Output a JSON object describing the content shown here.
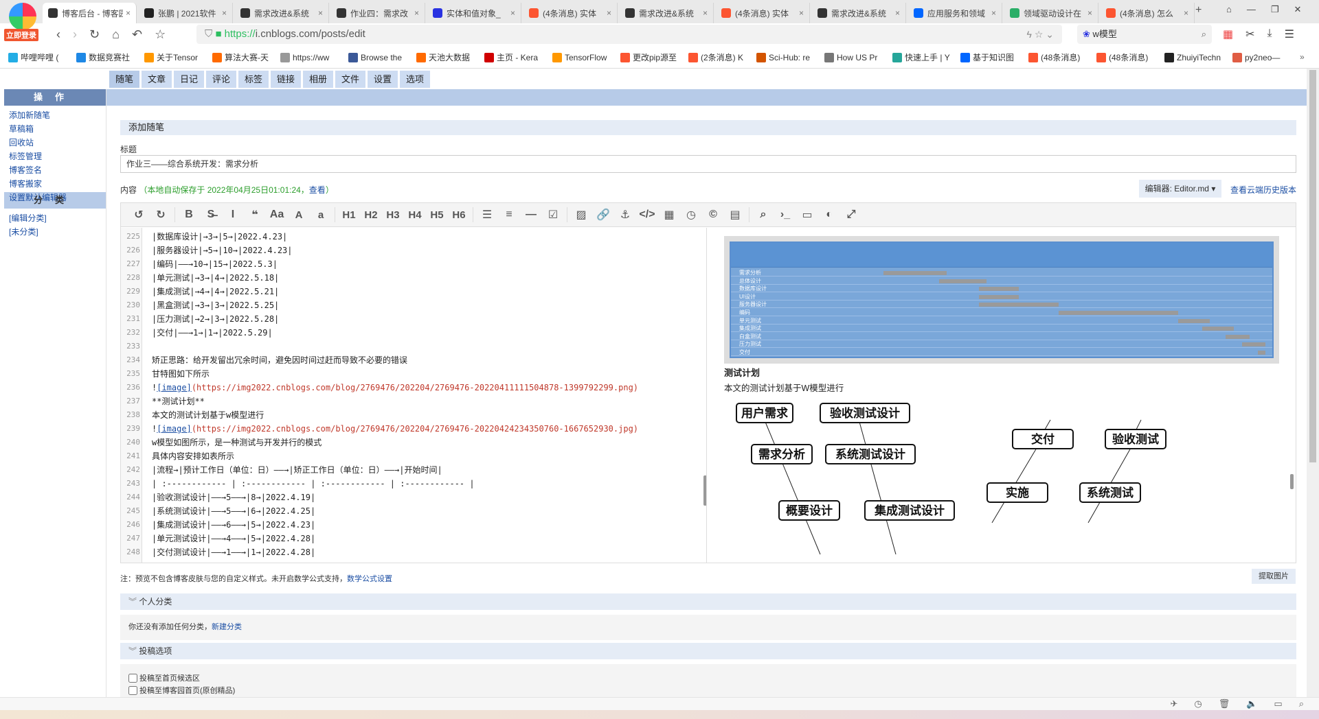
{
  "browser": {
    "login_badge": "立即登录",
    "tabs": [
      {
        "title": "博客后台 - 博客园",
        "icon": "cnblogs-icon",
        "color": "#333",
        "active": true
      },
      {
        "title": "张鹏 | 2021软件",
        "icon": "github-icon",
        "color": "#222"
      },
      {
        "title": "需求改进&系统",
        "icon": "cnblogs-icon",
        "color": "#333"
      },
      {
        "title": "作业四：需求改",
        "icon": "cnblogs-icon",
        "color": "#333"
      },
      {
        "title": "实体和值对象_",
        "icon": "baidu-icon",
        "color": "#2932e1"
      },
      {
        "title": "(4条消息) 实体",
        "icon": "csdn-icon",
        "color": "#fc5531"
      },
      {
        "title": "需求改进&系统",
        "icon": "cnblogs-icon",
        "color": "#333"
      },
      {
        "title": "(4条消息) 实体",
        "icon": "csdn-icon",
        "color": "#fc5531"
      },
      {
        "title": "需求改进&系统",
        "icon": "cnblogs-icon",
        "color": "#333"
      },
      {
        "title": "应用服务和领域",
        "icon": "zhihu-icon",
        "color": "#0066ff"
      },
      {
        "title": "领域驱动设计在",
        "icon": "wechat-icon",
        "color": "#2aae67"
      },
      {
        "title": "(4条消息) 怎么",
        "icon": "csdn-icon",
        "color": "#fc5531"
      }
    ],
    "url_scheme": "https://",
    "url_rest": "i.cnblogs.com/posts/edit",
    "search_value": "w模型",
    "bookmarks": [
      {
        "label": "哔哩哔哩 (",
        "color": "#23ade5"
      },
      {
        "label": "数据竞赛社",
        "color": "#1e88e5"
      },
      {
        "label": "关于Tensor",
        "color": "#ff9800"
      },
      {
        "label": "算法大赛-天",
        "color": "#ff6a00"
      },
      {
        "label": "https://ww",
        "color": "#999"
      },
      {
        "label": "Browse the",
        "color": "#3b5998"
      },
      {
        "label": "天池大数据",
        "color": "#ff6a00"
      },
      {
        "label": "主页 - Kera",
        "color": "#d00000"
      },
      {
        "label": "TensorFlow",
        "color": "#ff9800"
      },
      {
        "label": "更改pip源至",
        "color": "#fc5531"
      },
      {
        "label": "(2条消息) K",
        "color": "#fc5531"
      },
      {
        "label": "Sci-Hub: re",
        "color": "#d35400"
      },
      {
        "label": "How US Pr",
        "color": "#777"
      },
      {
        "label": "快速上手 | Y",
        "color": "#26a69a"
      },
      {
        "label": "基于知识图",
        "color": "#0066ff"
      },
      {
        "label": "(48条消息)",
        "color": "#fc5531"
      },
      {
        "label": "(48条消息)",
        "color": "#fc5531"
      },
      {
        "label": "ZhuiyiTechn",
        "color": "#222"
      },
      {
        "label": "py2neo—",
        "color": "#e05d44"
      }
    ]
  },
  "nav_tabs": [
    "随笔",
    "文章",
    "日记",
    "评论",
    "标签",
    "链接",
    "相册",
    "文件",
    "设置",
    "选项"
  ],
  "sidebar": {
    "ops_header": "操作",
    "ops": [
      "添加新随笔",
      "草稿箱",
      "回收站",
      "标签管理",
      "博客签名",
      "博客搬家",
      "设置默认编辑器"
    ],
    "cat_header": "分类",
    "cats": [
      "[编辑分类]",
      "[未分类]"
    ]
  },
  "form": {
    "section_title": "添加随笔",
    "title_label": "标题",
    "title_value": "作业三——综合系统开发：需求分析",
    "content_label": "内容",
    "autosave": "（本地自动保存于 2022年04月25日01:01:24，",
    "view_link": "查看",
    "autosave_end": "）",
    "editor_select": "编辑器: Editor.md",
    "history_link": "查看云端历史版本"
  },
  "toolbar": [
    "undo-icon",
    "redo-icon",
    "|",
    "bold-icon",
    "strikethrough-icon",
    "italic-icon",
    "quote-icon",
    "uppercase-icon",
    "A",
    "a",
    "|",
    "H1",
    "H2",
    "H3",
    "H4",
    "H5",
    "H6",
    "|",
    "list-ul-icon",
    "list-ol-icon",
    "hr-icon",
    "checkbox-icon",
    "|",
    "image-icon",
    "link-icon",
    "anchor-icon",
    "code-icon",
    "table-icon",
    "datetime-icon",
    "copyright-icon",
    "template-icon",
    "|",
    "search-icon",
    "terminal-icon",
    "preview-icon",
    "watch-icon",
    "fullscreen-icon"
  ],
  "code_lines": [
    {
      "n": "225",
      "t": "|数据库设计|→3→|5→|2022.4.23|"
    },
    {
      "n": "226",
      "t": "|服务器设计|→5→|10→|2022.4.23|"
    },
    {
      "n": "227",
      "t": "|编码|——→10→|15→|2022.5.3|"
    },
    {
      "n": "228",
      "t": "|单元测试|→3→|4→|2022.5.18|"
    },
    {
      "n": "229",
      "t": "|集成测试|→4→|4→|2022.5.21|"
    },
    {
      "n": "230",
      "t": "|黑盒测试|→3→|3→|2022.5.25|"
    },
    {
      "n": "231",
      "t": "|压力测试|→2→|3→|2022.5.28|"
    },
    {
      "n": "232",
      "t": "|交付|——→1→|1→|2022.5.29|"
    },
    {
      "n": "233",
      "t": ""
    },
    {
      "n": "234",
      "t": "矫正思路：给开发留出冗余时间，避免因时间过赶而导致不必要的错误"
    },
    {
      "n": "235",
      "t": "甘特图如下所示"
    },
    {
      "n": "236",
      "link": "[image]",
      "url": "(https://img2022.cnblogs.com/blog/2769476/202204/2769476-20220411111504878-1399792299.png)"
    },
    {
      "n": "237",
      "t": "**测试计划**"
    },
    {
      "n": "238",
      "t": "本文的测试计划基于w模型进行"
    },
    {
      "n": "239",
      "link": "[image]",
      "url": "(https://img2022.cnblogs.com/blog/2769476/202204/2769476-20220424234350760-1667652930.jpg)"
    },
    {
      "n": "240",
      "t": "w模型如图所示，是一种测试与开发并行的模式"
    },
    {
      "n": "241",
      "t": "具体内容安排如表所示"
    },
    {
      "n": "242",
      "t": "|流程→|预计工作日（单位：日）——→|矫正工作日（单位：日）——→|开始时间|"
    },
    {
      "n": "243",
      "t": "| :------------ | :------------ | :------------ | :------------ |"
    },
    {
      "n": "244",
      "t": "|验收测试设计|——→5——→|8→|2022.4.19|"
    },
    {
      "n": "245",
      "t": "|系统测试设计|——→5——→|6→|2022.4.25|"
    },
    {
      "n": "246",
      "t": "|集成测试设计|——→6——→|5→|2022.4.23|"
    },
    {
      "n": "247",
      "t": "|单元测试设计|——→4——→|5→|2022.4.28|"
    },
    {
      "n": "248",
      "t": "|交付测试设计|——→1——→|1→|2022.4.28|"
    }
  ],
  "preview": {
    "gantt_tasks": [
      "需求分析",
      "总体设计",
      "数据库设计",
      "UI设计",
      "服务器设计",
      "编码",
      "单元测试",
      "集成测试",
      "白盒测试",
      "压力测试",
      "交付"
    ],
    "heading": "测试计划",
    "paragraph": "本文的测试计划基于W模型进行",
    "wmodel_nodes": [
      "用户需求",
      "验收测试设计",
      "需求分析",
      "系统测试设计",
      "概要设计",
      "集成测试设计",
      "交付",
      "验收测试",
      "实施",
      "系统测试"
    ]
  },
  "note": {
    "text": "注：预览不包含博客皮肤与您的自定义样式。未开启数学公式支持，",
    "link": "数学公式设置"
  },
  "extract_button": "提取图片",
  "personal_category": {
    "title": "个人分类",
    "empty_text": "你还没有添加任何分类，",
    "new_link": "新建分类"
  },
  "post_options": {
    "title": "投稿选项",
    "options": [
      {
        "label": "投稿至首页候选区",
        "checked": false
      },
      {
        "label": "投稿至博客园首页(原创精品)",
        "checked": false
      }
    ]
  }
}
